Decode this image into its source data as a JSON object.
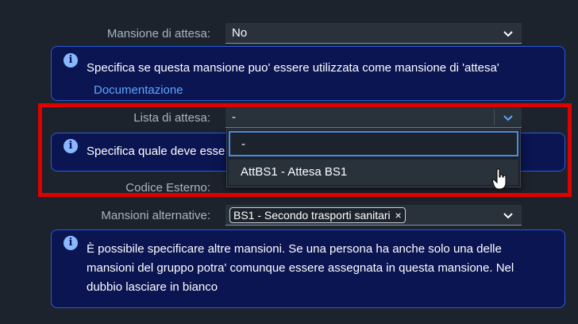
{
  "fields": {
    "mansione_attesa": {
      "label": "Mansione di attesa:",
      "value": "No",
      "info": "Specifica se questa mansione puo' essere utilizzata come mansione di 'attesa'",
      "link": "Documentazione"
    },
    "lista_attesa": {
      "label": "Lista di attesa:",
      "value": "-",
      "info": "Specifica quale deve esse",
      "dropdown": {
        "search_value": "-",
        "options": [
          "AttBS1 - Attesa BS1"
        ]
      }
    },
    "codice_esterno": {
      "label": "Codice Esterno:"
    },
    "mansioni_alternative": {
      "label": "Mansioni alternative:",
      "token": "BS1 - Secondo trasporti sanitari",
      "token_remove": "×",
      "info_line1": "È possibile specificare altre mansioni. Se una persona ha anche solo una delle",
      "info_line2": "mansioni del gruppo potra' comunque essere assegnata in questa mansione. Nel",
      "info_line3": "dubbio lasciare in bianco"
    }
  },
  "info_icon_glyph": "i",
  "colors": {
    "background": "#1d232c",
    "info_bg": "#0a1552",
    "info_border": "#2a5bd7",
    "link": "#5ea6ff",
    "highlight": "#e00000",
    "focus": "#4a8be0"
  }
}
